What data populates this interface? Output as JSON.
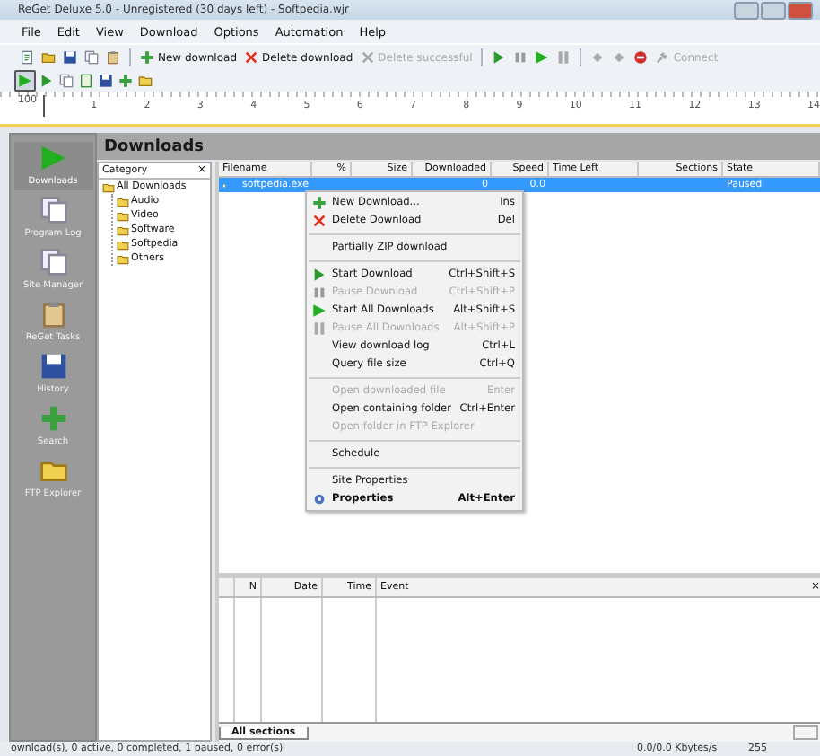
{
  "window": {
    "title": "ReGet Deluxe 5.0 - Unregistered (30 days left) - Softpedia.wjr"
  },
  "menu_bar": [
    "File",
    "Edit",
    "View",
    "Download",
    "Options",
    "Automation",
    "Help"
  ],
  "toolbar": [
    {
      "kind": "icon"
    },
    {
      "kind": "icon"
    },
    {
      "kind": "icon"
    },
    {
      "kind": "icon"
    },
    {
      "kind": "icon"
    },
    {
      "kind": "button",
      "label": "New download",
      "disabled": false
    },
    {
      "kind": "button",
      "label": "Delete download",
      "disabled": false
    },
    {
      "kind": "button",
      "label": "Delete successful",
      "disabled": true
    },
    {
      "kind": "icon"
    },
    {
      "kind": "icon"
    },
    {
      "kind": "icon"
    },
    {
      "kind": "icon"
    },
    {
      "kind": "icon"
    },
    {
      "kind": "icon"
    },
    {
      "kind": "icon"
    },
    {
      "kind": "button",
      "label": "Connect",
      "disabled": true
    }
  ],
  "ruler": [
    "100",
    "1",
    "2",
    "3",
    "4",
    "5",
    "6",
    "7",
    "8",
    "9",
    "10",
    "11",
    "12",
    "13",
    "14"
  ],
  "panel": {
    "title": "Downloads"
  },
  "sidebar": {
    "items": [
      {
        "label": "Downloads",
        "selected": true
      },
      {
        "label": "Program Log",
        "selected": false
      },
      {
        "label": "Site Manager",
        "selected": false
      },
      {
        "label": "ReGet Tasks",
        "selected": false
      },
      {
        "label": "History",
        "selected": false
      },
      {
        "label": "Search",
        "selected": false
      },
      {
        "label": "FTP Explorer",
        "selected": false
      }
    ]
  },
  "category": {
    "header": "Category",
    "close": "×",
    "tree": [
      {
        "label": "All Downloads",
        "children": [
          {
            "label": "Audio"
          },
          {
            "label": "Video"
          },
          {
            "label": "Software"
          },
          {
            "label": "Softpedia"
          },
          {
            "label": "Others"
          }
        ]
      }
    ]
  },
  "table": {
    "columns": [
      "Filename",
      "%",
      "Size",
      "Downloaded",
      "Speed",
      "Time Left",
      "Sections",
      "State"
    ],
    "rows": [
      {
        "selected": true,
        "cells": [
          "softpedia.exe",
          "",
          "",
          "0",
          "0.0",
          "",
          "",
          "Paused"
        ]
      }
    ]
  },
  "context_menu": [
    {
      "kind": "item",
      "label": "New Download...",
      "shortcut": "Ins",
      "disabled": false,
      "bold": false
    },
    {
      "kind": "item",
      "label": "Delete Download",
      "shortcut": "Del",
      "disabled": false,
      "bold": false
    },
    {
      "kind": "separator"
    },
    {
      "kind": "item",
      "label": "Partially ZIP download",
      "disabled": false,
      "bold": false
    },
    {
      "kind": "separator"
    },
    {
      "kind": "item",
      "label": "Start Download",
      "shortcut": "Ctrl+Shift+S",
      "disabled": false,
      "bold": false
    },
    {
      "kind": "item",
      "label": "Pause Download",
      "shortcut": "Ctrl+Shift+P",
      "disabled": true,
      "bold": false
    },
    {
      "kind": "item",
      "label": "Start All Downloads",
      "shortcut": "Alt+Shift+S",
      "disabled": false,
      "bold": false
    },
    {
      "kind": "item",
      "label": "Pause All Downloads",
      "shortcut": "Alt+Shift+P",
      "disabled": true,
      "bold": false
    },
    {
      "kind": "item",
      "label": "View download log",
      "shortcut": "Ctrl+L",
      "disabled": false,
      "bold": false
    },
    {
      "kind": "item",
      "label": "Query file size",
      "shortcut": "Ctrl+Q",
      "disabled": false,
      "bold": false
    },
    {
      "kind": "separator"
    },
    {
      "kind": "item",
      "label": "Open downloaded file",
      "shortcut": "Enter",
      "disabled": true,
      "bold": false
    },
    {
      "kind": "item",
      "label": "Open containing folder",
      "shortcut": "Ctrl+Enter",
      "disabled": false,
      "bold": false
    },
    {
      "kind": "item",
      "label": "Open folder in FTP Explorer",
      "disabled": true,
      "bold": false
    },
    {
      "kind": "separator"
    },
    {
      "kind": "item",
      "label": "Schedule",
      "disabled": false,
      "bold": false
    },
    {
      "kind": "separator"
    },
    {
      "kind": "item",
      "label": "Site Properties",
      "disabled": false,
      "bold": false
    },
    {
      "kind": "item",
      "label": "Properties",
      "shortcut": "Alt+Enter",
      "disabled": false,
      "bold": true
    }
  ],
  "log": {
    "columns": [
      "N",
      "Date",
      "Time",
      "Event"
    ],
    "close": "×",
    "tabs": [
      {
        "label": "All sections",
        "selected": true
      }
    ]
  },
  "status_bar": [
    "ownload(s), 0 active, 0 completed, 1 paused, 0 error(s)",
    "0.0/0.0 Kbytes/s",
    "255"
  ]
}
